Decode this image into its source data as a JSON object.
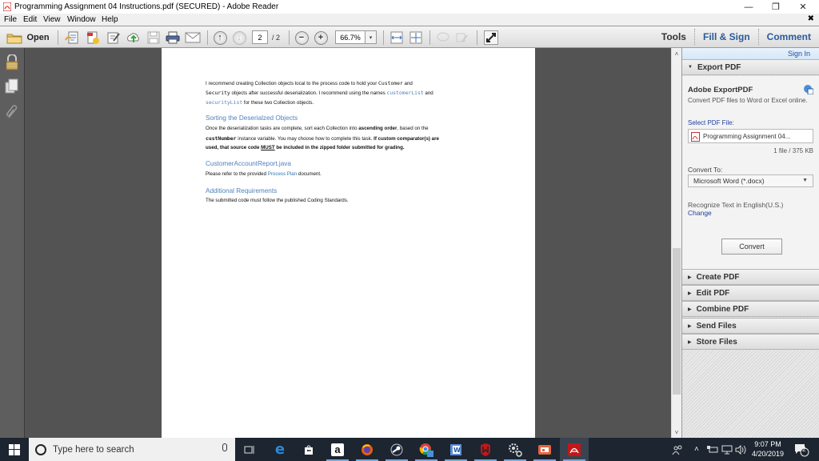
{
  "window": {
    "title": "Programming Assignment 04 Instructions.pdf (SECURED) - Adobe Reader",
    "controls": {
      "minimize": "—",
      "restore": "❐",
      "close": "✕"
    }
  },
  "menu": {
    "items": [
      "File",
      "Edit",
      "View",
      "Window",
      "Help"
    ],
    "doc_close": "✖"
  },
  "toolbar": {
    "open_label": "Open",
    "icons": [
      "create-pdf-icon",
      "export-pdf-icon",
      "edit-icon",
      "upload-cloud-icon",
      "save-icon",
      "print-icon",
      "email-icon"
    ],
    "current_page": "2",
    "total_pages": "/ 2",
    "zoom": "66.7%",
    "zoom_dropdown": "▾",
    "right_tabs": [
      "Tools",
      "Fill & Sign",
      "Comment"
    ]
  },
  "left_nav": {
    "icons": [
      "security-lock-icon",
      "pages-icon",
      "attachments-icon"
    ]
  },
  "document": {
    "para1": {
      "l1_pre": "I recommend creating Collection objects local to the process code to hold your ",
      "l1_code": "Customer",
      "l1_post": " and",
      "l2_code": "Security",
      "l2_mid": " objects after successful deserialization. I recommend using the names ",
      "l2_code2": "customerList",
      "l2_post": " and",
      "l3_code": "securityList",
      "l3_post": " for these two Collection objects."
    },
    "heading_sorting": "Sorting the Deserialzed Objects",
    "para2": {
      "l1_pre": "Once the deserialization tasks are complete, sort each Collection into ",
      "l1_bold": "ascending order",
      "l1_post": ", based on the",
      "l2_code": "custNumber",
      "l2_mid": " instance variable. You may choose how to complete this task. ",
      "l2_bold": "If custom comparator(s) are",
      "l3_bold_pre": "used, that source code ",
      "l3_under": "MUST",
      "l3_bold_post": " be included in the zipped folder submitted for grading."
    },
    "heading_report": "CustomerAccountReport.java",
    "para3": {
      "pre": "Please refer to the provided ",
      "link": "Process Plan",
      "post": " document."
    },
    "heading_additional": "Additional Requirements",
    "para4": "The submitted code must follow the published Coding Standards."
  },
  "right_pane": {
    "sign_in": "Sign In",
    "export_pdf": {
      "header": "Export PDF",
      "title": "Adobe ExportPDF",
      "description": "Convert PDF files to Word or Excel online.",
      "select_label": "Select PDF File:",
      "file_name": "Programming Assignment 04...",
      "file_info": "1 file / 375 KB",
      "convert_to_label": "Convert To:",
      "format": "Microsoft Word (*.docx)",
      "recognize": "Recognize Text in English(U.S.)",
      "change_link": "Change",
      "convert_button": "Convert"
    },
    "sections": [
      "Create PDF",
      "Edit PDF",
      "Combine PDF",
      "Send Files",
      "Store Files"
    ]
  },
  "scrollbar": {
    "position_fraction": 0.51
  },
  "taskbar": {
    "search_placeholder": "Type here to search",
    "apps": [
      "task-view",
      "edge",
      "store",
      "amazon",
      "firefox",
      "steam",
      "chrome-people",
      "word",
      "mcafee",
      "settings",
      "powerpoint-video",
      "adobe-reader"
    ],
    "clock_time": "9:07 PM",
    "clock_date": "4/20/2019",
    "notification_count": "2"
  }
}
